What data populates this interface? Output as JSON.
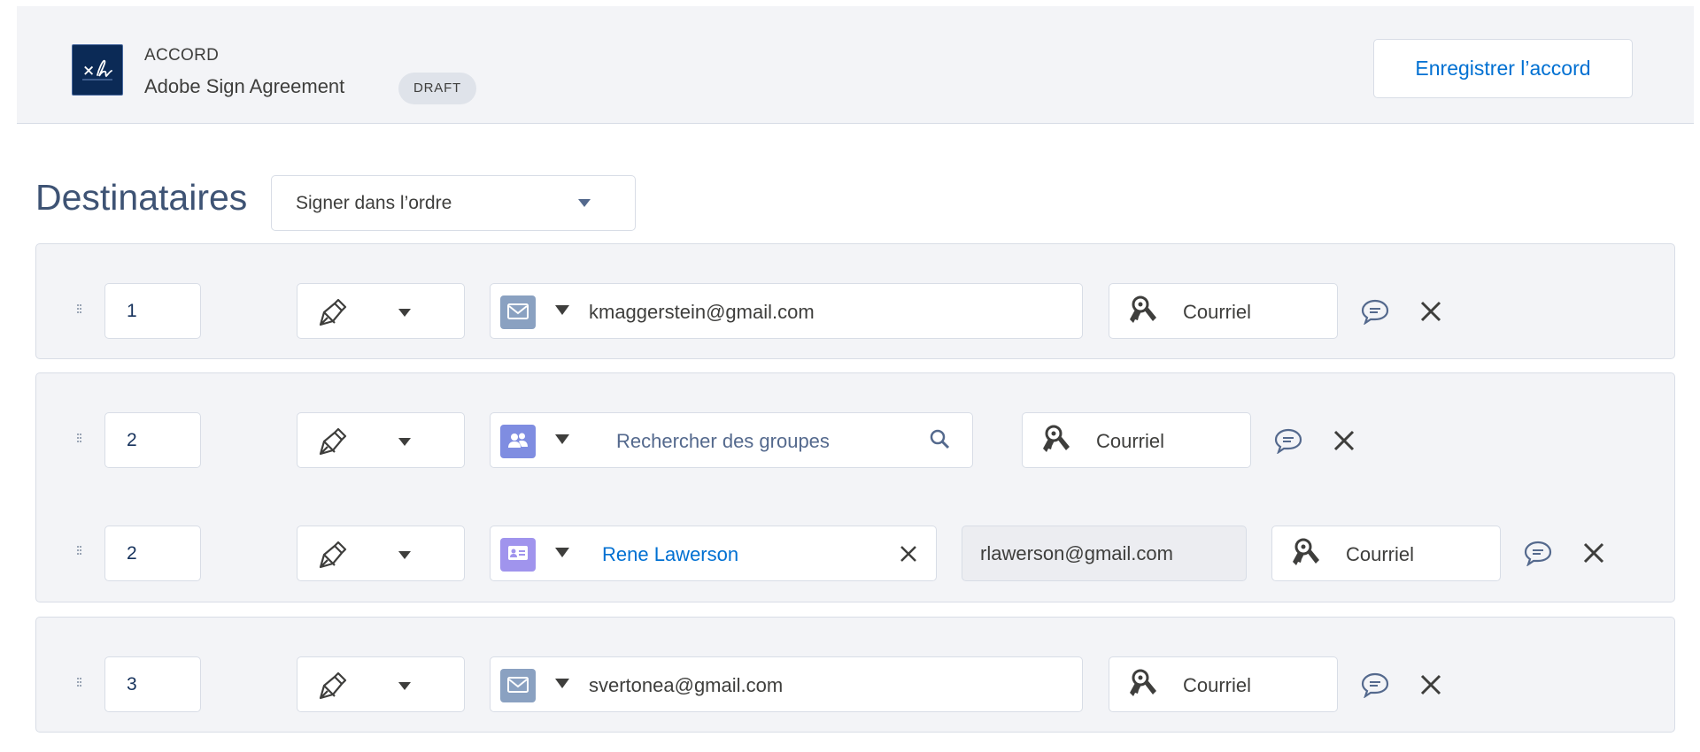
{
  "header": {
    "kicker": "ACCORD",
    "title": "Adobe Sign Agreement",
    "status_badge": "DRAFT",
    "save_label": "Enregistrer l’accord"
  },
  "recipients": {
    "title": "Destinataires",
    "order_select": {
      "value": "Signer dans l’ordre"
    },
    "rows": [
      {
        "order": "1",
        "role_icon": "pen-icon",
        "type_icon": "email-icon",
        "value": "kmaggerstein@gmail.com",
        "auth": "Courriel"
      },
      {
        "order": "2",
        "role_icon": "pen-icon",
        "type_icon": "group-icon",
        "placeholder": "Rechercher des groupes",
        "auth": "Courriel"
      },
      {
        "order": "2",
        "role_icon": "pen-icon",
        "type_icon": "contact-icon",
        "value": "Rene Lawerson",
        "email": "rlawerson@gmail.com",
        "auth": "Courriel"
      },
      {
        "order": "3",
        "role_icon": "pen-icon",
        "type_icon": "email-icon",
        "value": "svertonea@gmail.com",
        "auth": "Courriel"
      }
    ]
  },
  "colors": {
    "accent": "#0070d2",
    "email_icon_bg": "#8aa1c1",
    "group_icon_bg": "#7f8de1",
    "contact_icon_bg": "#a094ed",
    "row_bg": "#f3f4f7",
    "border": "#d8dde6"
  }
}
